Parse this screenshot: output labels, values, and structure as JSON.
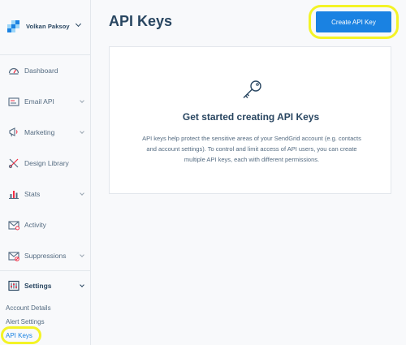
{
  "account": {
    "name": "Volkan Paksoy"
  },
  "sidebar": {
    "items": [
      {
        "label": "Dashboard",
        "icon": "dashboard-icon"
      },
      {
        "label": "Email API",
        "icon": "email-api-icon"
      },
      {
        "label": "Marketing",
        "icon": "marketing-icon"
      },
      {
        "label": "Design Library",
        "icon": "design-library-icon"
      },
      {
        "label": "Stats",
        "icon": "stats-icon"
      },
      {
        "label": "Activity",
        "icon": "activity-icon"
      },
      {
        "label": "Suppressions",
        "icon": "suppressions-icon"
      },
      {
        "label": "Settings",
        "icon": "settings-icon"
      }
    ],
    "settings_submenu": [
      {
        "label": "Account Details"
      },
      {
        "label": "Alert Settings"
      },
      {
        "label": "API Keys"
      }
    ]
  },
  "header": {
    "title": "API Keys",
    "create_button": "Create API Key"
  },
  "empty_state": {
    "icon": "key-icon",
    "title": "Get started creating API Keys",
    "description": "API keys help protect the sensitive areas of your SendGrid account (e.g. contacts and account settings). To control and limit access of API users, you can create multiple API keys, each with different permissions."
  },
  "colors": {
    "accent": "#1a82e2",
    "highlight": "#f3f326",
    "text": "#294661"
  }
}
